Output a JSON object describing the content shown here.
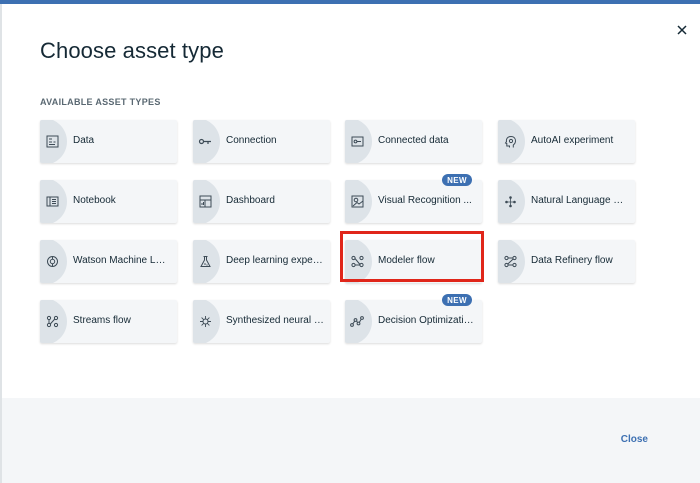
{
  "dialog": {
    "title": "Choose asset type",
    "section_label": "AVAILABLE ASSET TYPES",
    "close_button": "Close"
  },
  "assets": [
    {
      "label": "Data",
      "icon": "data-icon"
    },
    {
      "label": "Connection",
      "icon": "connection-icon"
    },
    {
      "label": "Connected data",
      "icon": "connected-data-icon"
    },
    {
      "label": "AutoAI experiment",
      "icon": "autoai-icon"
    },
    {
      "label": "Notebook",
      "icon": "notebook-icon"
    },
    {
      "label": "Dashboard",
      "icon": "dashboard-icon"
    },
    {
      "label": "Visual Recognition ...",
      "icon": "visual-recognition-icon",
      "badge": "NEW"
    },
    {
      "label": "Natural Language Cl...",
      "icon": "natural-language-icon"
    },
    {
      "label": "Watson Machine Lea...",
      "icon": "watson-ml-icon"
    },
    {
      "label": "Deep learning experi...",
      "icon": "deep-learning-icon"
    },
    {
      "label": "Modeler flow",
      "icon": "modeler-flow-icon"
    },
    {
      "label": "Data Refinery flow",
      "icon": "data-refinery-icon"
    },
    {
      "label": "Streams flow",
      "icon": "streams-flow-icon"
    },
    {
      "label": "Synthesized neural n...",
      "icon": "synthesized-neural-icon"
    },
    {
      "label": "Decision Optimizatio...",
      "icon": "decision-optimization-icon",
      "badge": "NEW"
    }
  ],
  "colors": {
    "accent": "#3d70b2",
    "highlight": "#e0261a",
    "tile_bg": "#f4f6f8",
    "text": "#152935"
  }
}
